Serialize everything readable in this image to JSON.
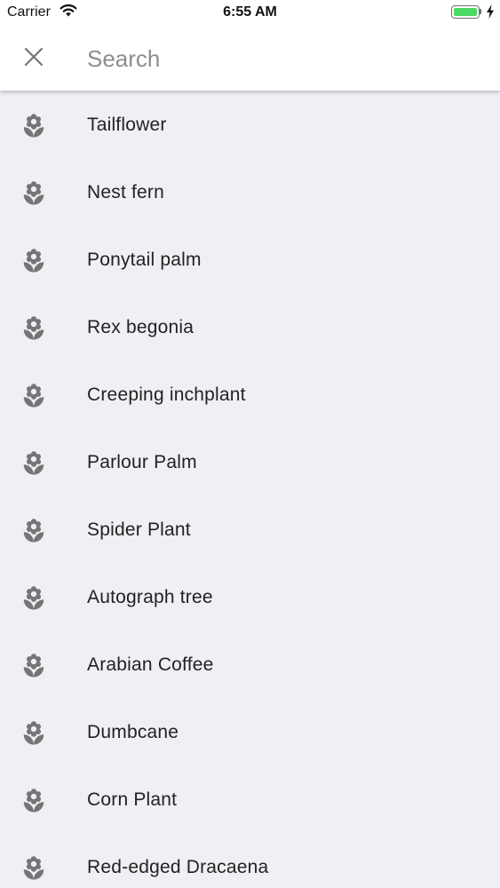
{
  "status_bar": {
    "carrier": "Carrier",
    "time": "6:55 AM",
    "battery_level": 1.0,
    "battery_color": "#4cd964"
  },
  "search": {
    "placeholder": "Search",
    "value": "",
    "close_icon": "close-icon"
  },
  "results": {
    "icon": "flower-icon",
    "icon_color": "#757575",
    "items": [
      {
        "label": "Tailflower"
      },
      {
        "label": "Nest fern"
      },
      {
        "label": "Ponytail palm"
      },
      {
        "label": "Rex begonia"
      },
      {
        "label": "Creeping inchplant"
      },
      {
        "label": "Parlour Palm"
      },
      {
        "label": "Spider Plant"
      },
      {
        "label": "Autograph tree"
      },
      {
        "label": "Arabian Coffee"
      },
      {
        "label": "Dumbcane"
      },
      {
        "label": "Corn Plant"
      },
      {
        "label": "Red-edged Dracaena"
      }
    ]
  }
}
